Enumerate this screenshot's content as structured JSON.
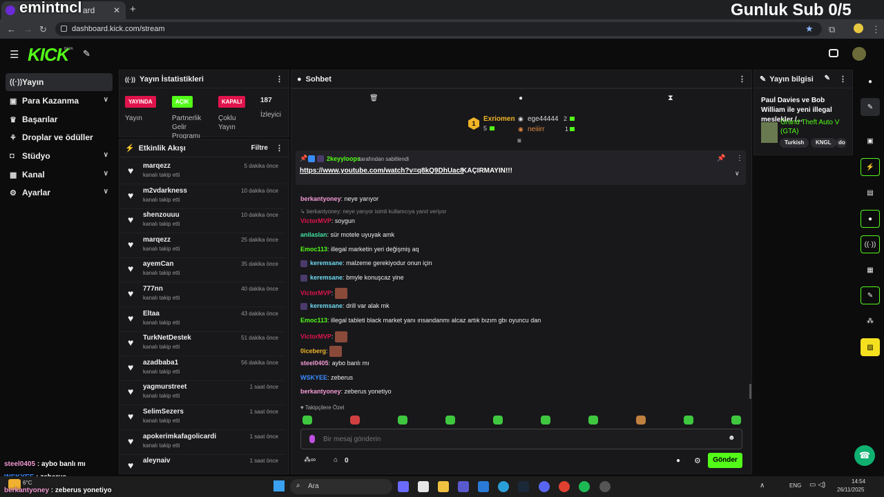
{
  "browser": {
    "tab_title": "dashboard",
    "tab_fragment": "ard",
    "overlay_channel": "emintncl",
    "overlay_goal": "Gunluk Sub 0/5",
    "url": "dashboard.kick.com/stream"
  },
  "header": {
    "logo": "KICK",
    "logo_badge": "BETA"
  },
  "sidebar": {
    "items": [
      {
        "label": "Yayın",
        "icon": "broadcast-icon",
        "has_chevron": false,
        "active": true
      },
      {
        "label": "Para Kazanma",
        "icon": "money-icon",
        "has_chevron": true
      },
      {
        "label": "Başarılar",
        "icon": "trophy-icon",
        "has_chevron": false
      },
      {
        "label": "Droplar ve ödüller",
        "icon": "gift-icon",
        "has_chevron": false
      },
      {
        "label": "Stüdyo",
        "icon": "studio-icon",
        "has_chevron": true
      },
      {
        "label": "Kanal",
        "icon": "channel-icon",
        "has_chevron": true
      },
      {
        "label": "Ayarlar",
        "icon": "gear-icon",
        "has_chevron": true
      }
    ]
  },
  "stats": {
    "title": "Yayın İstatistikleri",
    "items": [
      {
        "badge": "YAYINDA",
        "badge_color": "#e0144c",
        "label": "Yayın"
      },
      {
        "badge": "AÇIK",
        "badge_color": "#53fc18",
        "label": "Partnerlik Gelir Programı"
      },
      {
        "badge": "KAPALI",
        "badge_color": "#e0144c",
        "label": "Çoklu Yayın"
      },
      {
        "badge": "187",
        "label": "İzleyici"
      }
    ]
  },
  "activity": {
    "title": "Etkinlik Akışı",
    "filter_label": "Filtre",
    "events": [
      {
        "name": "marqezz",
        "action": "kanalı takip etti",
        "time": "5 dakika önce"
      },
      {
        "name": "m2vdarkness",
        "action": "kanalı takip etti",
        "time": "10 dakika önce"
      },
      {
        "name": "shenzouuu",
        "action": "kanalı takip etti",
        "time": "10 dakika önce"
      },
      {
        "name": "marqezz",
        "action": "kanalı takip etti",
        "time": "25 dakika önce"
      },
      {
        "name": "ayemCan",
        "action": "kanalı takip etti",
        "time": "35 dakika önce"
      },
      {
        "name": "777nn",
        "action": "kanalı takip etti",
        "time": "40 dakika önce"
      },
      {
        "name": "Eltaa",
        "action": "kanalı takip etti",
        "time": "43 dakika önce"
      },
      {
        "name": "TurkNetDestek",
        "action": "kanalı takip etti",
        "time": "51 dakika önce"
      },
      {
        "name": "azadbaba1",
        "action": "kanalı takip etti",
        "time": "56 dakika önce"
      },
      {
        "name": "yagmurstreet",
        "action": "kanalı takip etti",
        "time": "1 saat önce"
      },
      {
        "name": "SelimSezers",
        "action": "kanalı takip etti",
        "time": "1 saat önce"
      },
      {
        "name": "apokerimkafagolicardi",
        "action": "kanalı takip etti",
        "time": "1 saat önce"
      },
      {
        "name": "aleynaiv",
        "action": "",
        "time": "1 saat önce"
      }
    ]
  },
  "chat": {
    "title": "Sohbet",
    "leaderboard": {
      "first": {
        "rank": "1",
        "name": "Exriomen",
        "count": "5"
      },
      "second": {
        "name": "ege44444",
        "count": "2"
      },
      "third": {
        "name": "neiiirr",
        "count": "1"
      }
    },
    "pinned": {
      "pinned_by": "2keyyloops",
      "pinned_suffix": "tarafından sabitlendi",
      "link": "https://www.youtube.com/watch?v=q8kQ9DhUac8",
      "text": "KAÇIRMAYIN!!!"
    },
    "messages": [
      {
        "user": "berkantyoney",
        "color": "#f59bd4",
        "text": "neye yarıyor"
      },
      {
        "reply": "berkantyoney: neye yarıyor isimli kullanıcıya yanıt veriyor"
      },
      {
        "user": "VictorMVP",
        "color": "#e0144c",
        "text": "soygun"
      },
      {
        "user": "anilaslan",
        "color": "#3fe0a0",
        "text": "sür motele uyuyak amk"
      },
      {
        "user": "Emoc113",
        "color": "#53fc18",
        "text": "illegal marketin yeri değişmiş aq"
      },
      {
        "user": "keremsane",
        "color": "#6fd9f0",
        "text": "malzeme gerekiyodur onun için",
        "badge": true
      },
      {
        "user": "keremsane",
        "color": "#6fd9f0",
        "text": "bmyle konuşcaz yine",
        "badge": true
      },
      {
        "user": "VictorMVP",
        "color": "#e0144c",
        "text": "",
        "emote": true
      },
      {
        "user": "keremsane",
        "color": "#6fd9f0",
        "text": "drill var alak mk",
        "badge": true
      },
      {
        "user": "Emoc113",
        "color": "#53fc18",
        "text": "illegal tableti black market yanı ınsandanmı alcaz artık bızım gbı oyuncu dan"
      },
      {
        "user": "VictorMVP",
        "color": "#e0144c",
        "text": "",
        "emote": true
      },
      {
        "user": "0iceberg",
        "color": "#f0b428",
        "text": "",
        "emote": true
      },
      {
        "user": "steel0405",
        "color": "#f59bd4",
        "text": "aybo banlı mı"
      },
      {
        "user": "WSKYEE",
        "color": "#3a8cff",
        "text": "zeberus"
      },
      {
        "user": "berkantyoney",
        "color": "#f59bd4",
        "text": "zeberus yonetiyo"
      }
    ],
    "followers_only": "Takipçilere Özel",
    "input_placeholder": "Bir mesaj gönderin",
    "points": "0",
    "send_label": "Gönder"
  },
  "stream_info": {
    "title_label": "Yayın bilgisi",
    "stream_title": "Paul Davies ve Bob William ile yeni illegal meslekler /...",
    "category": "Grand Theft Auto V (GTA)",
    "tags": [
      "Turkish",
      "KNGL",
      "do"
    ]
  },
  "overlay_chat": [
    {
      "user": "steel0405",
      "text": "aybo banlı mı"
    },
    {
      "user": "WSKYEE",
      "text": "zeberus"
    },
    {
      "user": "berkantyoney",
      "text": "zeberus yonetiyo"
    }
  ],
  "taskbar": {
    "search": "Ara",
    "lang": "ENG",
    "time": "14:54",
    "date": "26/11/2025",
    "weather": "6°C"
  },
  "colors": {
    "accent": "#53fc18",
    "live": "#e0144c",
    "panel": "#18181b"
  }
}
